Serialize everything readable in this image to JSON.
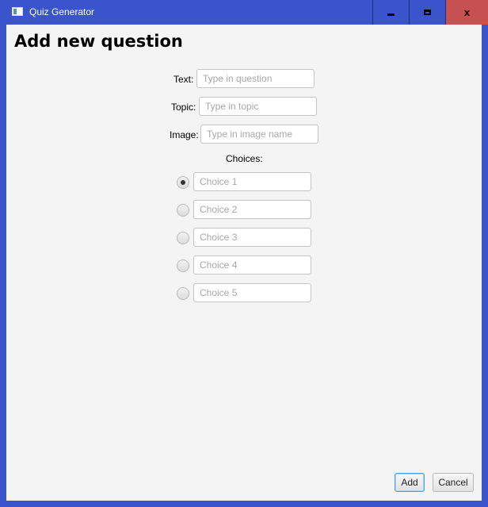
{
  "window": {
    "title": "Quiz Generator",
    "controls": {
      "minimize": "–",
      "maximize": "□",
      "close": "x"
    }
  },
  "form": {
    "heading": "Add new question",
    "text": {
      "label": "Text:",
      "placeholder": "Type in question",
      "value": ""
    },
    "topic": {
      "label": "Topic:",
      "placeholder": "Type in topic",
      "value": ""
    },
    "image": {
      "label": "Image:",
      "placeholder": "Type in image name",
      "value": ""
    },
    "choices_label": "Choices:",
    "choices": [
      {
        "placeholder": "Choice 1",
        "selected": true
      },
      {
        "placeholder": "Choice 2",
        "selected": false
      },
      {
        "placeholder": "Choice 3",
        "selected": false
      },
      {
        "placeholder": "Choice 4",
        "selected": false
      },
      {
        "placeholder": "Choice 5",
        "selected": false
      }
    ]
  },
  "buttons": {
    "add": "Add",
    "cancel": "Cancel"
  },
  "colors": {
    "title_bar": "#3a54cc",
    "close_button": "#c75050",
    "content_bg": "#f4f4f4",
    "focus_border": "#48a0dc"
  }
}
